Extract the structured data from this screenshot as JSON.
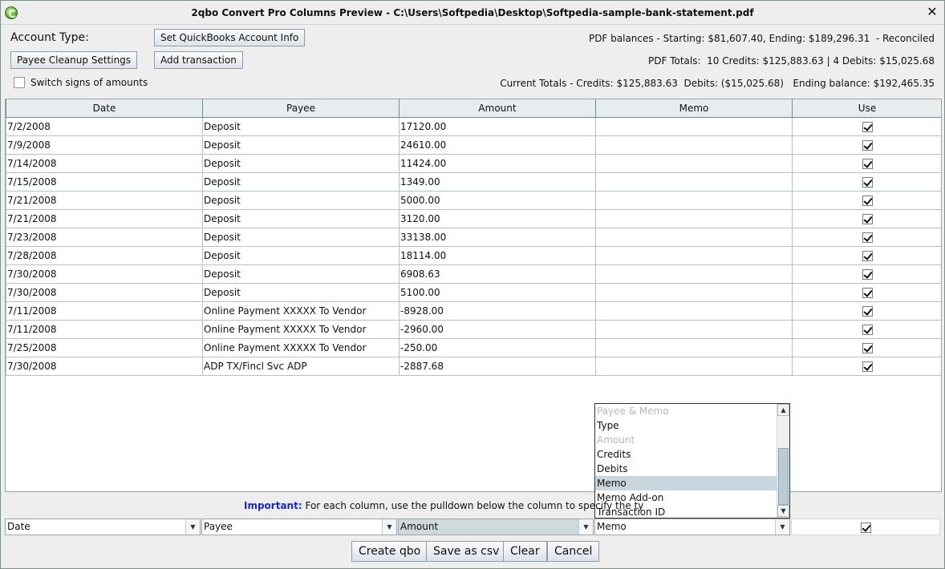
{
  "window": {
    "title": "2qbo Convert Pro Columns Preview - C:\\Users\\Softpedia\\Desktop\\Softpedia-sample-bank-statement.pdf",
    "close_glyph": "✕"
  },
  "toolbar": {
    "account_type_label": "Account Type:",
    "set_quickbooks_label": "Set QuickBooks Account Info",
    "payee_cleanup_label": "Payee Cleanup Settings",
    "add_transaction_label": "Add transaction",
    "switch_signs_label": "Switch signs of amounts",
    "switch_signs_checked": false
  },
  "info": {
    "pdf_balances": "PDF balances - Starting: $81,607.40, Ending: $189,296.31  - Reconciled",
    "pdf_totals": "PDF Totals:  10 Credits: $125,883.63 | 4 Debits: $15,025.68",
    "current_totals": "Current Totals - Credits: $125,883.63  Debits: ($15,025.68)   Ending balance: $192,465.35"
  },
  "table": {
    "columns": [
      "Date",
      "Payee",
      "Amount",
      "Memo",
      "Use"
    ],
    "rows": [
      {
        "date": "7/2/2008",
        "payee": "Deposit",
        "amount": "17120.00",
        "memo": "",
        "use": true
      },
      {
        "date": "7/9/2008",
        "payee": "Deposit",
        "amount": "24610.00",
        "memo": "",
        "use": true
      },
      {
        "date": "7/14/2008",
        "payee": "Deposit",
        "amount": "11424.00",
        "memo": "",
        "use": true
      },
      {
        "date": "7/15/2008",
        "payee": "Deposit",
        "amount": "1349.00",
        "memo": "",
        "use": true
      },
      {
        "date": "7/21/2008",
        "payee": "Deposit",
        "amount": "5000.00",
        "memo": "",
        "use": true
      },
      {
        "date": "7/21/2008",
        "payee": "Deposit",
        "amount": "3120.00",
        "memo": "",
        "use": true
      },
      {
        "date": "7/23/2008",
        "payee": "Deposit",
        "amount": "33138.00",
        "memo": "",
        "use": true
      },
      {
        "date": "7/28/2008",
        "payee": "Deposit",
        "amount": "18114.00",
        "memo": "",
        "use": true
      },
      {
        "date": "7/30/2008",
        "payee": "Deposit",
        "amount": "6908.63",
        "memo": "",
        "use": true
      },
      {
        "date": "7/30/2008",
        "payee": "Deposit",
        "amount": "5100.00",
        "memo": "",
        "use": true
      },
      {
        "date": "7/11/2008",
        "payee": "Online Payment XXXXX To Vendor",
        "amount": "-8928.00",
        "memo": "",
        "use": true
      },
      {
        "date": "7/11/2008",
        "payee": "Online Payment XXXXX To Vendor",
        "amount": "-2960.00",
        "memo": "",
        "use": true
      },
      {
        "date": "7/25/2008",
        "payee": "Online Payment XXXXX To Vendor",
        "amount": "-250.00",
        "memo": "",
        "use": true
      },
      {
        "date": "7/30/2008",
        "payee": "ADP TX/Fincl Svc ADP",
        "amount": "-2887.68",
        "memo": "",
        "use": true
      }
    ]
  },
  "memo_dropdown": {
    "options": [
      {
        "label": "Payee & Memo",
        "disabled": true,
        "selected": false
      },
      {
        "label": "Type",
        "disabled": false,
        "selected": false
      },
      {
        "label": "Amount",
        "disabled": true,
        "selected": false
      },
      {
        "label": "Credits",
        "disabled": false,
        "selected": false
      },
      {
        "label": "Debits",
        "disabled": false,
        "selected": false
      },
      {
        "label": "Memo",
        "disabled": false,
        "selected": true
      },
      {
        "label": "Memo Add-on",
        "disabled": false,
        "selected": false
      },
      {
        "label": "Transaction ID",
        "disabled": false,
        "selected": false
      }
    ]
  },
  "instructions": {
    "important_label": "Important:",
    "text": "For each column, use the pulldown below the column to specify the ty"
  },
  "column_selectors": {
    "date": "Date",
    "payee": "Payee",
    "amount": "Amount",
    "memo": "Memo",
    "use_checked": true
  },
  "actions": {
    "create_qbo": "Create qbo",
    "save_csv": "Save as csv",
    "clear": "Clear",
    "cancel": "Cancel"
  }
}
